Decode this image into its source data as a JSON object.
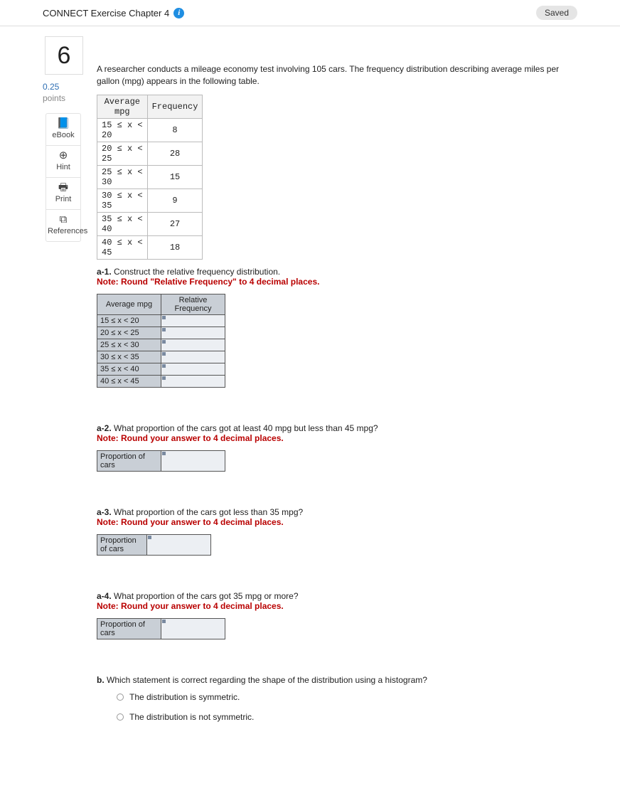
{
  "header": {
    "title": "CONNECT Exercise Chapter 4",
    "saved": "Saved"
  },
  "question": {
    "number": "6",
    "points_value": "0.25",
    "points_label": "points"
  },
  "sidebar": [
    {
      "icon": "📘",
      "label": "eBook",
      "name": "ebook-button"
    },
    {
      "icon": "⊕",
      "label": "Hint",
      "name": "hint-button"
    },
    {
      "icon": "🖶",
      "label": "Print",
      "name": "print-button"
    },
    {
      "icon": "⧉",
      "label": "References",
      "name": "references-button"
    }
  ],
  "prompt": "A researcher conducts a mileage economy test involving 105 cars. The frequency distribution describing average miles per gallon (mpg) appears in the following table.",
  "freq_table": {
    "col1": "Average\nmpg",
    "col2": "Frequency",
    "rows": [
      {
        "range": "15 ≤ x <\n20",
        "freq": "8"
      },
      {
        "range": "20 ≤ x <\n25",
        "freq": "28"
      },
      {
        "range": "25 ≤ x <\n30",
        "freq": "15"
      },
      {
        "range": "30 ≤ x <\n35",
        "freq": "9"
      },
      {
        "range": "35 ≤ x <\n40",
        "freq": "27"
      },
      {
        "range": "40 ≤ x <\n45",
        "freq": "18"
      }
    ]
  },
  "a1": {
    "label": "a-1.",
    "text": " Construct the relative frequency distribution.",
    "note": "Note: Round \"Relative Frequency\" to 4 decimal places.",
    "col1": "Average mpg",
    "col2": "Relative Frequency",
    "rows": [
      "15 ≤ x < 20",
      "20 ≤ x < 25",
      "25 ≤ x < 30",
      "30 ≤ x < 35",
      "35 ≤ x < 40",
      "40 ≤ x < 45"
    ]
  },
  "a2": {
    "label": "a-2.",
    "text": " What proportion of the cars got at least 40 mpg but less than 45 mpg?",
    "note": "Note: Round your answer to 4 decimal places.",
    "row_label": "Proportion of cars"
  },
  "a3": {
    "label": "a-3.",
    "text": " What proportion of the cars got less than 35 mpg?",
    "note": "Note: Round your answer to 4 decimal places.",
    "row_label": "Proportion of cars"
  },
  "a4": {
    "label": "a-4.",
    "text": " What proportion of the cars got 35 mpg or more?",
    "note": "Note: Round your answer to 4 decimal places.",
    "row_label": "Proportion of cars"
  },
  "b": {
    "label": "b.",
    "text": " Which statement is correct regarding the shape of the distribution using a histogram?",
    "options": [
      "The distribution is symmetric.",
      "The distribution is not symmetric."
    ]
  }
}
